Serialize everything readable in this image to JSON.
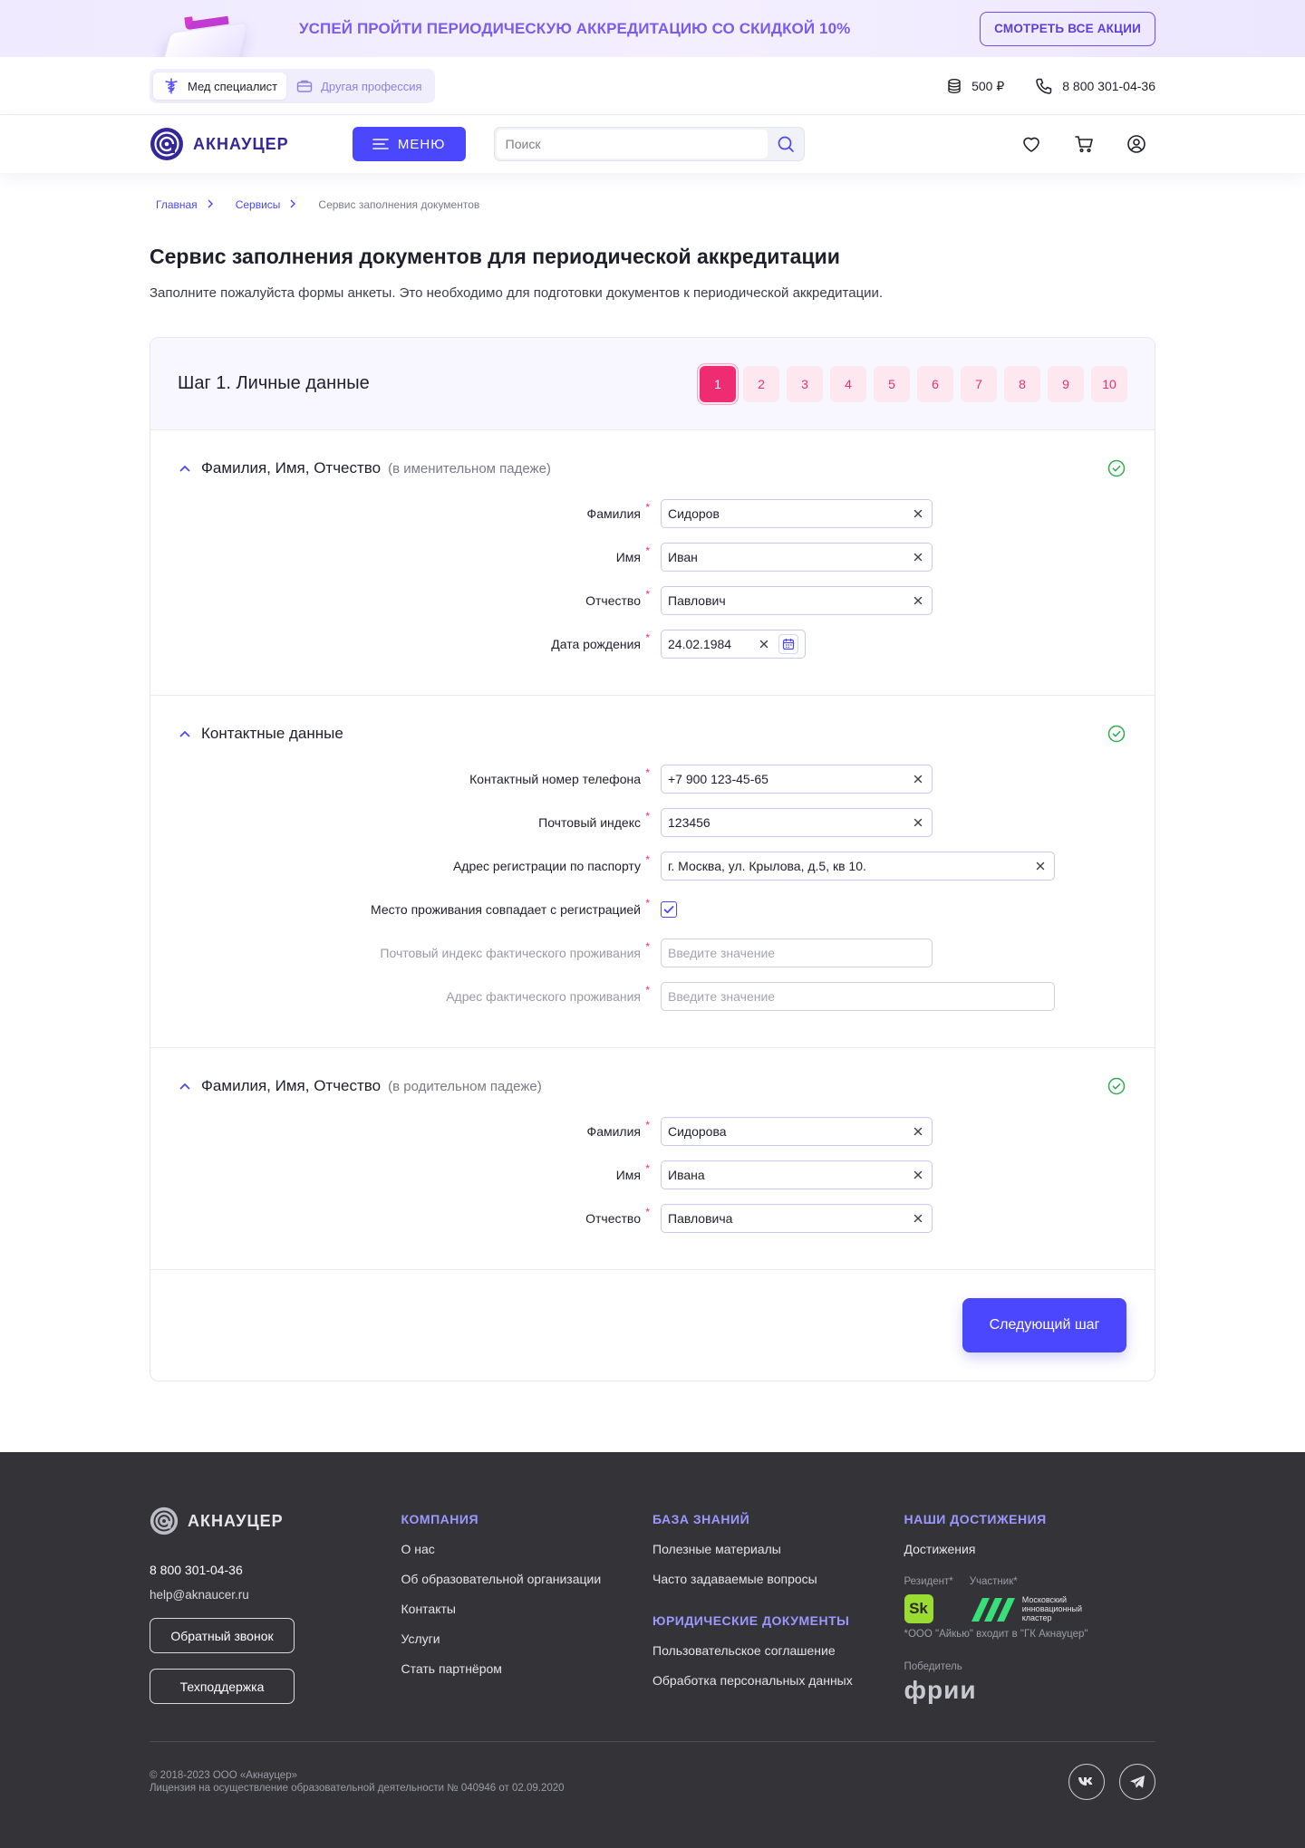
{
  "promo": {
    "text": "Успей пройти периодическую аккредитацию со скидкой 10%",
    "button": "СМОТРЕТЬ ВСЕ АКЦИИ"
  },
  "topbar": {
    "profession_options": [
      "Мед специалист",
      "Другая профессия"
    ],
    "balance": "500 ₽",
    "phone": "8 800 301-04-36"
  },
  "header": {
    "logo": "АКНАУЦЕР",
    "menu": "МЕНЮ",
    "search_placeholder": "Поиск"
  },
  "breadcrumbs": {
    "home": "Главная",
    "services": "Сервисы",
    "current": "Сервис заполнения документов"
  },
  "page": {
    "title": "Сервис заполнения документов для периодической аккредитации",
    "description": "Заполните пожалуйста формы анкеты. Это необходимо для подготовки документов к периодической аккредитации."
  },
  "form": {
    "step_title": "Шаг 1. Личные данные",
    "steps": [
      "1",
      "2",
      "3",
      "4",
      "5",
      "6",
      "7",
      "8",
      "9",
      "10"
    ],
    "active_step": "1",
    "sections": {
      "fio_nominative": {
        "title": "Фамилия, Имя, Отчество",
        "subtitle": "(в именительном падеже)",
        "fields": {
          "last_name": {
            "label": "Фамилия",
            "value": "Сидоров"
          },
          "first_name": {
            "label": "Имя",
            "value": "Иван"
          },
          "patronymic": {
            "label": "Отчество",
            "value": "Павлович"
          },
          "birth_date": {
            "label": "Дата рождения",
            "value": "24.02.1984"
          }
        }
      },
      "contacts": {
        "title": "Контактные данные",
        "fields": {
          "phone": {
            "label": "Контактный номер телефона",
            "value": "+7 900 123-45-65"
          },
          "postal": {
            "label": "Почтовый индекс",
            "value": "123456"
          },
          "reg_address": {
            "label": "Адрес регистрации по паспорту",
            "value": "г. Москва, ул. Крылова, д.5, кв 10."
          },
          "same_address": {
            "label": "Место проживания совпадает с регистрацией",
            "checked": true
          },
          "fact_postal": {
            "label": "Почтовый индекс фактического проживания",
            "placeholder": "Введите значение"
          },
          "fact_address": {
            "label": "Адрес фактического проживания",
            "placeholder": "Введите значение"
          }
        }
      },
      "fio_genitive": {
        "title": "Фамилия, Имя, Отчество",
        "subtitle": "(в родительном падеже)",
        "fields": {
          "last_name": {
            "label": "Фамилия",
            "value": "Сидорова"
          },
          "first_name": {
            "label": "Имя",
            "value": "Ивана"
          },
          "patronymic": {
            "label": "Отчество",
            "value": "Павловича"
          }
        }
      }
    },
    "required_mark": "*",
    "next_button": "Следующий шаг"
  },
  "footer": {
    "logo": "АКНАУЦЕР",
    "phone": "8 800 301-04-36",
    "email": "help@aknaucer.ru",
    "callback_button": "Обратный звонок",
    "support_button": "Техподдержка",
    "company": {
      "heading": "КОМПАНИЯ",
      "links": [
        "О нас",
        "Об образовательной организации",
        "Контакты",
        "Услуги",
        "Стать партнёром"
      ]
    },
    "knowledge": {
      "heading": "БАЗА ЗНАНИЙ",
      "links": [
        "Полезные материалы",
        "Часто задаваемые вопросы"
      ]
    },
    "legal": {
      "heading": "ЮРИДИЧЕСКИЕ ДОКУМЕНТЫ",
      "links": [
        "Пользовательское соглашение",
        "Обработка персональных данных"
      ]
    },
    "achievements": {
      "heading": "НАШИ ДОСТИЖЕНИЯ",
      "link": "Достижения",
      "resident_label": "Резидент*",
      "member_label": "Участник*",
      "sk_logo": "Sk",
      "cluster_text": "Московский инновационный кластер",
      "note": "*ООО \"Айкью\" входит в \"ГК Акнауцер\"",
      "winner_label": "Победитель",
      "frii_logo": "фрии"
    },
    "copyright": "© 2018-2023 ООО «Акнауцер»",
    "license": "Лицензия на осуществление образовательной деятельности № 040946 от 02.09.2020"
  },
  "colors": {
    "accent": "#4a47ff",
    "pink": "#ef2b72",
    "success": "#2fae4e",
    "footer_bg": "#333338"
  }
}
